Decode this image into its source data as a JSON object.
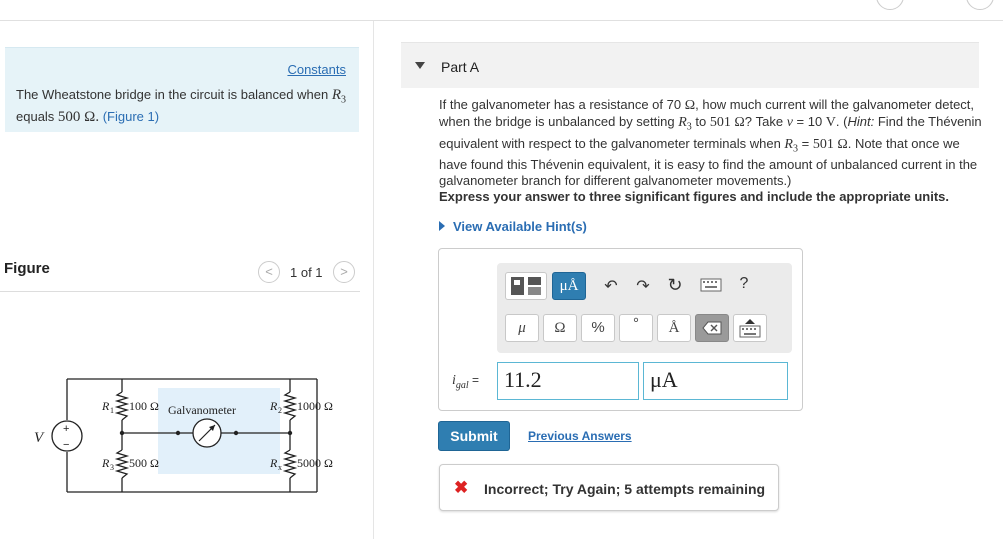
{
  "intro": {
    "constants_link": "Constants",
    "text_before_r3": "The Wheatstone bridge in the circuit is balanced when",
    "r3_symbol": "R",
    "r3_sub": "3",
    "text_equals": " equals ",
    "r3_value": "500 Ω.",
    "figure_ref": "(Figure 1)"
  },
  "figure": {
    "label": "Figure",
    "pager_text": "1 of 1",
    "prev_glyph": "<",
    "next_glyph": ">"
  },
  "circuit": {
    "source_label": "V",
    "plus_sign": "+",
    "minus_sign": "−",
    "r1_label": "R",
    "r1_sub": "1",
    "r1_value": "100 Ω",
    "r2_label": "R",
    "r2_sub": "2",
    "r2_value": "1000 Ω",
    "r3_label": "R",
    "r3_sub": "3",
    "r3_value": "500 Ω",
    "rx_label": "R",
    "rx_sub": "x",
    "rx_value": "5000 Ω",
    "galvanometer_label": "Galvanometer"
  },
  "part": {
    "title": "Part A"
  },
  "question": {
    "t1": "If the galvanometer has a resistance of 70 ",
    "ohm1": "Ω",
    "t2": ", how much current will the galvanometer detect, when the bridge is unbalanced by setting ",
    "r3a": "R",
    "r3a_sub": "3",
    "t3": " to ",
    "val501a": "501 Ω",
    "t4": "? Take ",
    "v_sym": "v",
    "t5": " = 10 ",
    "volt": "V",
    "t6": ". (",
    "hint_word": "Hint:",
    "t7": " Find the Thévenin equivalent with respect to the galvanometer terminals when ",
    "r3b": "R",
    "r3b_sub": "3",
    "t8": " = ",
    "val501b": "501 Ω",
    "t9": ". Note that once we have found this Thévenin equivalent, it is easy to find the amount of unbalanced current in the galvanometer branch for different galvanometer movements.)"
  },
  "instruction": "Express your answer to three significant figures and include the appropriate units.",
  "hints_link": "View Available Hint(s)",
  "toolbar": {
    "units_btn": "μÅ",
    "undo": "↶",
    "redo": "↷",
    "reset": "↻",
    "help": "?",
    "mu": "μ",
    "omega": "Ω",
    "percent": "%",
    "degree": "°",
    "angstrom": "Å"
  },
  "answer": {
    "var_symbol": "i",
    "var_sub": "gal",
    "equals": " =",
    "value": "11.2",
    "unit": "μA"
  },
  "submit_label": "Submit",
  "previous_answers": "Previous Answers",
  "feedback": {
    "icon": "✖",
    "text": "Incorrect; Try Again; 5 attempts remaining"
  },
  "colors": {
    "accent_blue": "#2f7eb1",
    "link_blue": "#2a6db3",
    "intro_bg": "#e6f3f8",
    "error_red": "#dd2222",
    "input_border": "#5bb7d4"
  }
}
